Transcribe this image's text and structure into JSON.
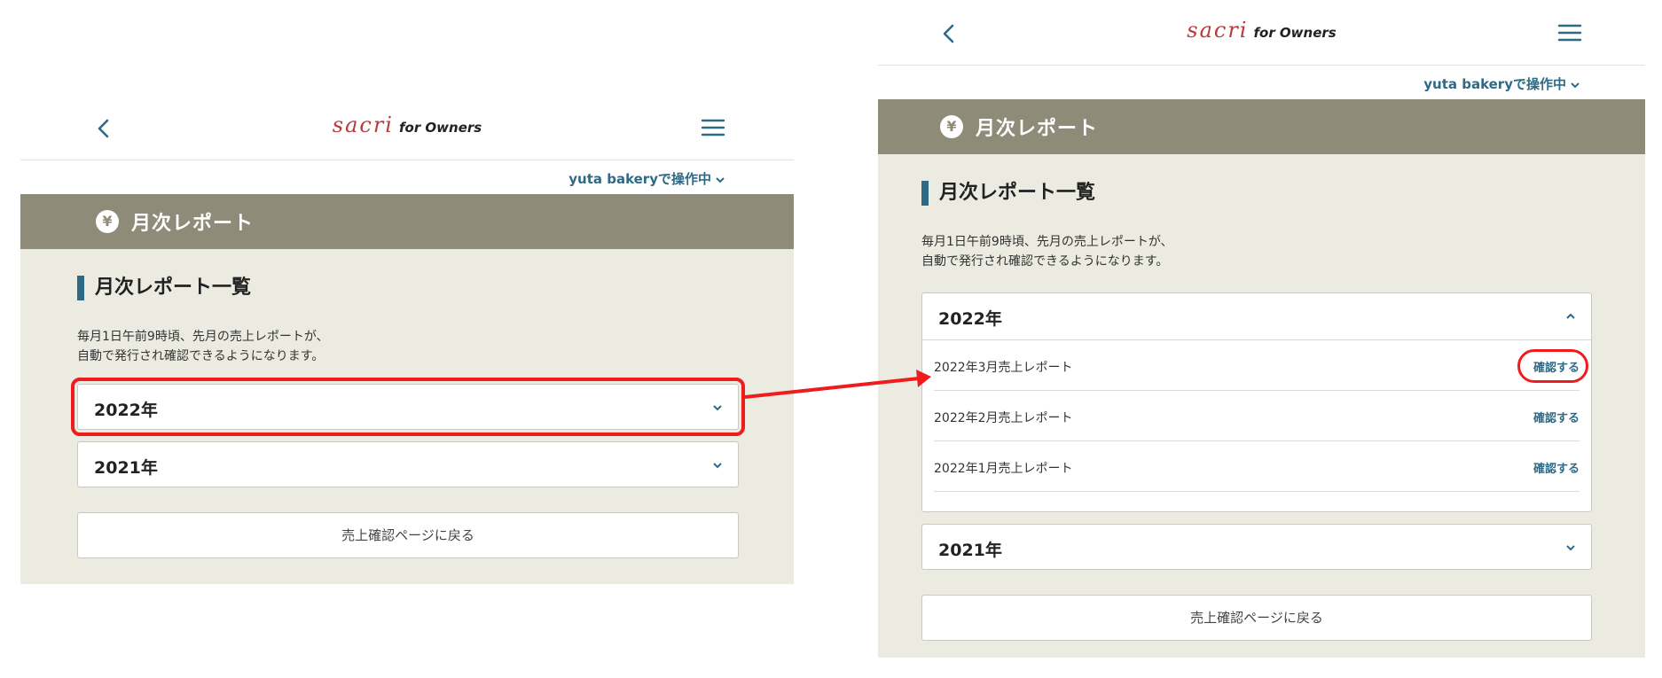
{
  "app": {
    "brand": "sacri",
    "brand_sub": "for Owners"
  },
  "store": {
    "label": "yuta bakeryで操作中"
  },
  "page": {
    "title": "月次レポート",
    "yen_glyph": "¥"
  },
  "section": {
    "heading": "月次レポート一覧",
    "desc_line1": "毎月1日午前9時頃、先月の売上レポートが、",
    "desc_line2": "自動で発行され確認できるようになります。"
  },
  "years": [
    {
      "label": "2022年",
      "reports": [
        {
          "label": "2022年3月売上レポート",
          "action": "確認する"
        },
        {
          "label": "2022年2月売上レポート",
          "action": "確認する"
        },
        {
          "label": "2022年1月売上レポート",
          "action": "確認する"
        }
      ]
    },
    {
      "label": "2021年"
    }
  ],
  "back_button": "売上確認ページに戻る",
  "colors": {
    "accent": "#2e6a86",
    "brand": "#b83a3a",
    "titlebar": "#8e8b78",
    "body_bg": "#ebebe1",
    "highlight": "#ee1c1c"
  }
}
